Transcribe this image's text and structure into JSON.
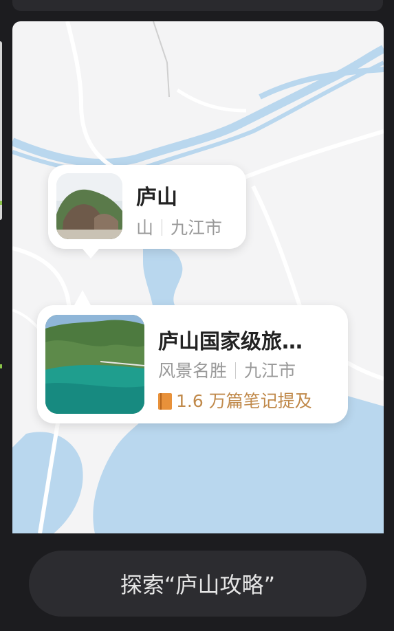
{
  "popup_primary": {
    "title": "庐山",
    "category": "山",
    "city": "九江市"
  },
  "popup_secondary": {
    "title": "庐山国家级旅…",
    "category": "风景名胜",
    "city": "九江市",
    "notes": "1.6 万篇笔记提及",
    "notes_icon": "book-icon"
  },
  "action": {
    "explore_label": "探索“庐山攻略”"
  },
  "colors": {
    "map_land": "#f4f4f5",
    "map_water": "#b9d7ee",
    "notes_accent": "#c0894a",
    "button_bg": "#2c2c30"
  }
}
